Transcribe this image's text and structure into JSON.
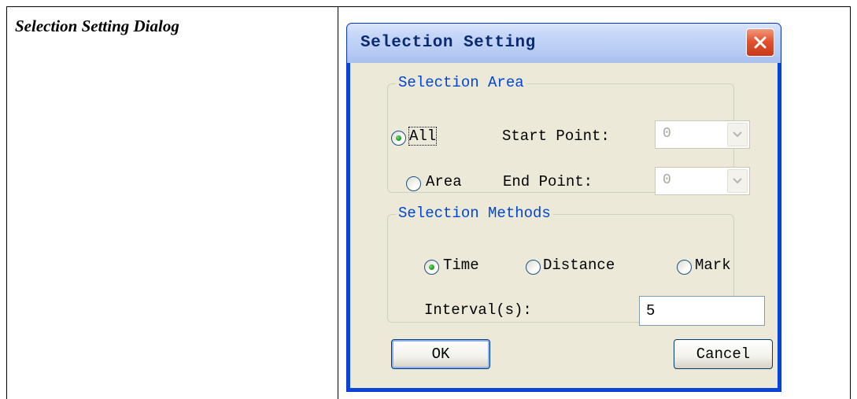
{
  "document": {
    "caption": "Selection Setting Dialog"
  },
  "dialog": {
    "title": "Selection Setting",
    "selection_area": {
      "legend": "Selection Area",
      "options": [
        {
          "label": "All",
          "selected": true
        },
        {
          "label": "Area",
          "selected": false
        }
      ],
      "start_point": {
        "label": "Start Point:",
        "value": "0"
      },
      "end_point": {
        "label": "End Point:",
        "value": "0"
      }
    },
    "selection_methods": {
      "legend": "Selection Methods",
      "options": [
        {
          "label": "Time",
          "selected": true
        },
        {
          "label": "Distance",
          "selected": false
        },
        {
          "label": "Mark",
          "selected": false
        }
      ],
      "interval": {
        "label": "Interval(s):",
        "value": "5"
      }
    },
    "buttons": {
      "ok": "OK",
      "cancel": "Cancel"
    }
  },
  "colors": {
    "title_text": "#0b2a72",
    "legend_text": "#0046d5",
    "dialog_face": "#ece9d8",
    "close_button": "#e2542f"
  },
  "icons": {
    "close": "close-icon",
    "dropdown": "chevron-down-icon"
  }
}
